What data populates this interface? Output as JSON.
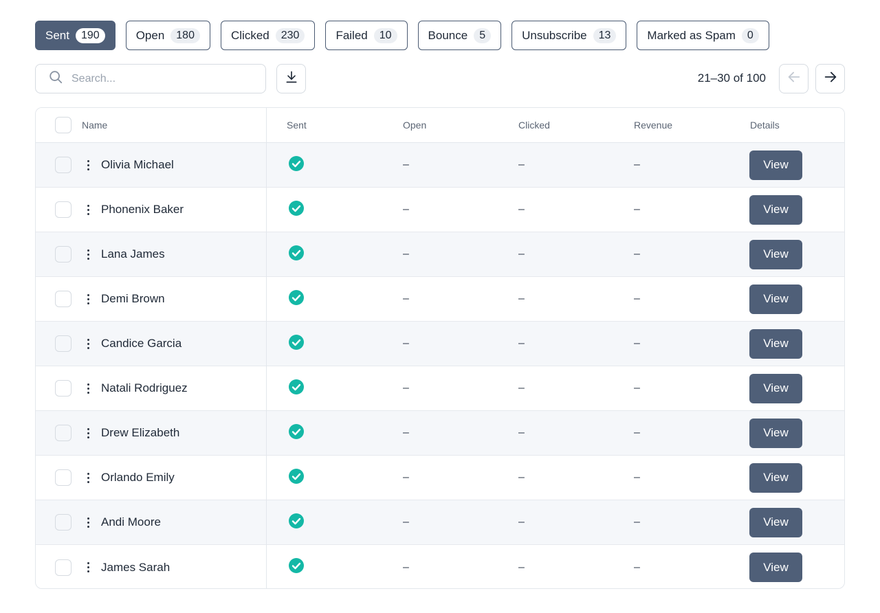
{
  "filters": [
    {
      "label": "Sent",
      "count": "190",
      "active": true
    },
    {
      "label": "Open",
      "count": "180",
      "active": false
    },
    {
      "label": "Clicked",
      "count": "230",
      "active": false
    },
    {
      "label": "Failed",
      "count": "10",
      "active": false
    },
    {
      "label": "Bounce",
      "count": "5",
      "active": false
    },
    {
      "label": "Unsubscribe",
      "count": "13",
      "active": false
    },
    {
      "label": "Marked as Spam",
      "count": "0",
      "active": false
    }
  ],
  "search": {
    "placeholder": "Search...",
    "value": ""
  },
  "pagination": {
    "range_text": "21–30 of 100"
  },
  "table": {
    "headers": {
      "name": "Name",
      "sent": "Sent",
      "open": "Open",
      "clicked": "Clicked",
      "revenue": "Revenue",
      "details": "Details"
    },
    "rows": [
      {
        "name": "Olivia Michael",
        "open": "–",
        "clicked": "–",
        "revenue": "–",
        "action": "View"
      },
      {
        "name": "Phonenix Baker",
        "open": "–",
        "clicked": "–",
        "revenue": "–",
        "action": "View"
      },
      {
        "name": "Lana James",
        "open": "–",
        "clicked": "–",
        "revenue": "–",
        "action": "View"
      },
      {
        "name": "Demi Brown",
        "open": "–",
        "clicked": "–",
        "revenue": "–",
        "action": "View"
      },
      {
        "name": "Candice Garcia",
        "open": "–",
        "clicked": "–",
        "revenue": "–",
        "action": "View"
      },
      {
        "name": "Natali Rodriguez",
        "open": "–",
        "clicked": "–",
        "revenue": "–",
        "action": "View"
      },
      {
        "name": "Drew Elizabeth",
        "open": "–",
        "clicked": "–",
        "revenue": "–",
        "action": "View"
      },
      {
        "name": "Orlando Emily",
        "open": "–",
        "clicked": "–",
        "revenue": "–",
        "action": "View"
      },
      {
        "name": "Andi Moore",
        "open": "–",
        "clicked": "–",
        "revenue": "–",
        "action": "View"
      },
      {
        "name": "James Sarah",
        "open": "–",
        "clicked": "–",
        "revenue": "–",
        "action": "View"
      }
    ]
  },
  "icons": {
    "search": "search-icon",
    "download": "download-icon",
    "prev": "arrow-left-icon",
    "next": "arrow-right-icon",
    "sent_status": "check-circle-icon",
    "row_menu": "kebab-menu-icon"
  },
  "colors": {
    "primary": "#4f5f78",
    "success": "#14b8a6",
    "border": "#e3e7ec",
    "row_alt": "#f5f7fa"
  }
}
